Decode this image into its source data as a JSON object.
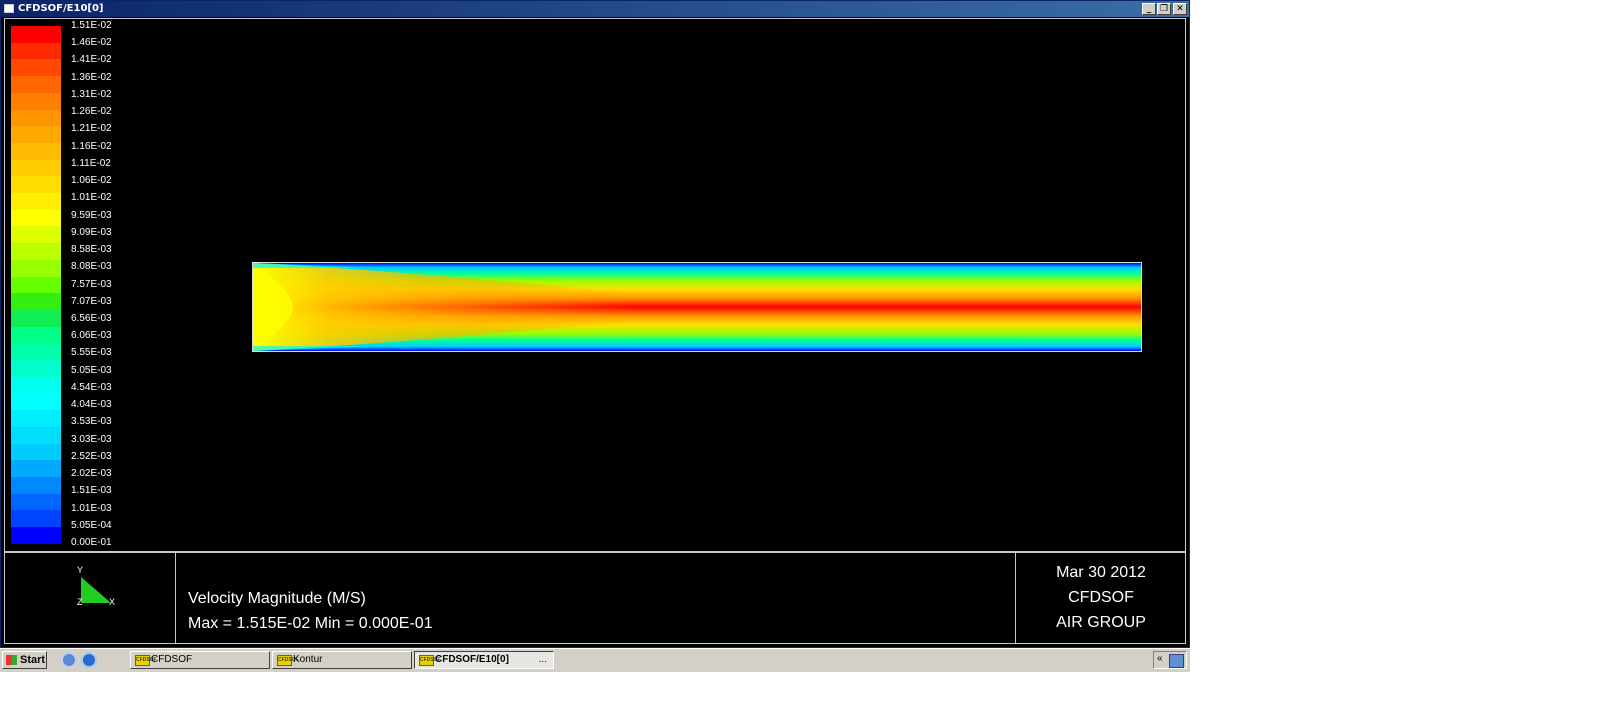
{
  "window": {
    "title": "CFDSOF/E10[0]",
    "minimize_label": "_",
    "restore_label": "❐",
    "close_label": "✕"
  },
  "legend": {
    "labels": [
      "1.51E-02",
      "1.46E-02",
      "1.41E-02",
      "1.36E-02",
      "1.31E-02",
      "1.26E-02",
      "1.21E-02",
      "1.16E-02",
      "1.11E-02",
      "1.06E-02",
      "1.01E-02",
      "9.59E-03",
      "9.09E-03",
      "8.58E-03",
      "8.08E-03",
      "7.57E-03",
      "7.07E-03",
      "6.56E-03",
      "6.06E-03",
      "5.55E-03",
      "5.05E-03",
      "4.54E-03",
      "4.04E-03",
      "3.53E-03",
      "3.03E-03",
      "2.52E-03",
      "2.02E-03",
      "1.51E-03",
      "1.01E-03",
      "5.05E-04",
      "0.00E-01"
    ],
    "colors": [
      "#ff0000",
      "#ff2a00",
      "#ff4a00",
      "#ff6600",
      "#ff7f00",
      "#ff9500",
      "#ffaa00",
      "#ffbb00",
      "#ffcc00",
      "#ffdd00",
      "#ffee00",
      "#ffff00",
      "#ddff00",
      "#bbff00",
      "#99ff00",
      "#66ff00",
      "#33ee11",
      "#11ee55",
      "#00ff88",
      "#00ffaa",
      "#00ffcc",
      "#00ffee",
      "#00ffff",
      "#00eeff",
      "#00ddff",
      "#00ccff",
      "#00aaff",
      "#0088ff",
      "#0066ff",
      "#0044ff",
      "#0000ff"
    ]
  },
  "info": {
    "axis_y": "Y",
    "axis_z": "Z",
    "axis_x": "X",
    "variable_title": "Velocity Magnitude (M/S)",
    "range_text": "Max = 1.515E-02   Min = 0.000E-01",
    "date": "Mar 30 2012",
    "product": "CFDSOF",
    "company": "AIR GROUP"
  },
  "taskbar": {
    "start_label": "Start",
    "items": [
      {
        "label": "CFDSOF",
        "icon_text": "CFDSOF"
      },
      {
        "label": "Kontur",
        "icon_text": "CFDSOF"
      },
      {
        "label": "CFDSOF/E10[0]",
        "icon_text": "CFDSOF",
        "suffix": "..."
      }
    ],
    "tray_chevron": "«"
  }
}
